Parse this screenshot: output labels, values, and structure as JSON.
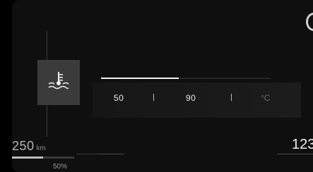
{
  "coolant": {
    "icon": "coolant-temperature-icon",
    "fill_fraction": 0.46,
    "scale_min": "50",
    "scale_mid": "90",
    "unit": "°C"
  },
  "range": {
    "value": "250",
    "unit": "km"
  },
  "fuel": {
    "percent_label": "50%",
    "fill_fraction": 0.5
  },
  "odometer": {
    "partial_value": "123"
  }
}
